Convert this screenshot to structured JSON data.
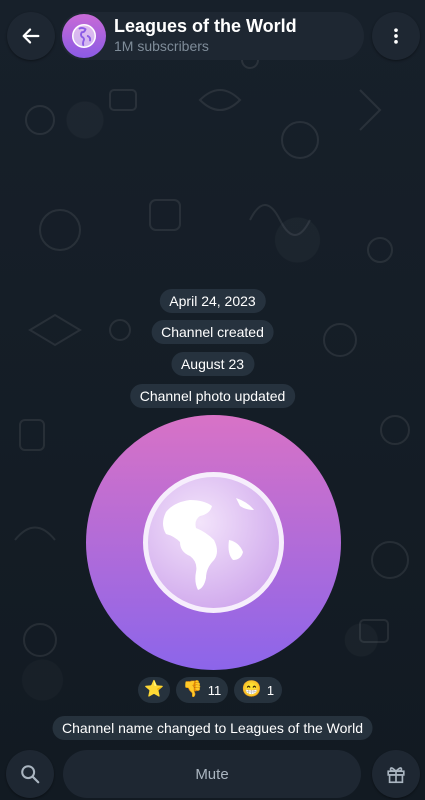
{
  "header": {
    "title": "Leagues of the World",
    "subscribers": "1M subscribers"
  },
  "messages": [
    {
      "text": "April 24, 2023",
      "kind": "date"
    },
    {
      "text": "Channel created",
      "kind": "service"
    },
    {
      "text": "August 23",
      "kind": "date"
    },
    {
      "text": "Channel photo updated",
      "kind": "service"
    }
  ],
  "reactions": [
    {
      "emoji": "⭐",
      "count": "",
      "icon": "star-icon"
    },
    {
      "emoji": "👎",
      "count": "11",
      "icon": "thumbs-down-icon"
    },
    {
      "emoji": "😁",
      "count": "1",
      "icon": "grin-icon"
    }
  ],
  "last_service": "Channel name changed to Leagues of the World",
  "bottom": {
    "mute_label": "Mute"
  },
  "colors": {
    "background": "#141b22",
    "bar": "#1e2732",
    "photo_top": "#d872c6",
    "photo_bottom": "#8c65ea"
  }
}
